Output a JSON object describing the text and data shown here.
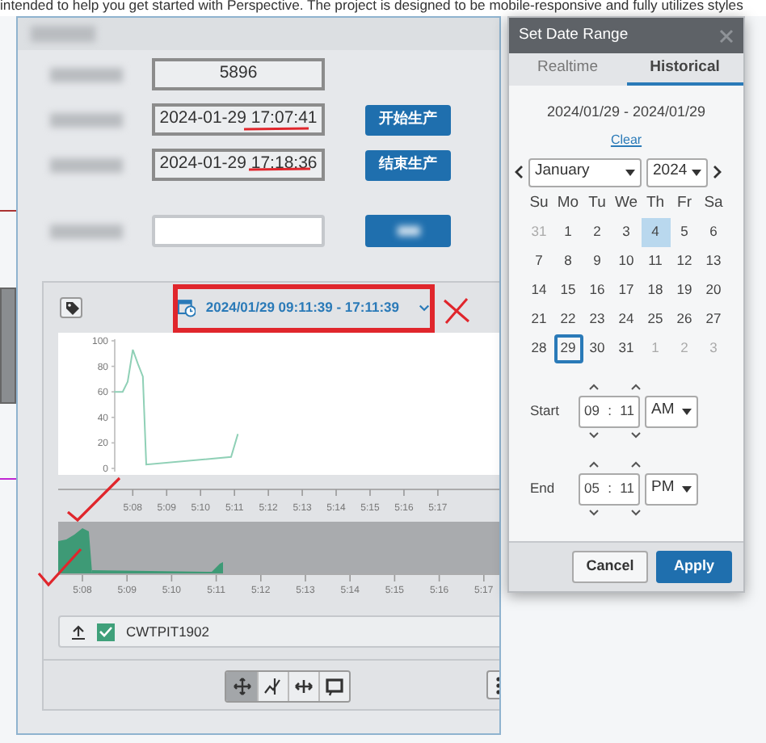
{
  "intro_text": "intended to help you get started with Perspective. The project is designed to be mobile-responsive and fully utilizes styles",
  "form": {
    "rows": [
      {
        "kind": "readout",
        "value": "5896"
      },
      {
        "kind": "readout_with_button",
        "value": "2024-01-29 17:07:41",
        "button": "开始生产"
      },
      {
        "kind": "readout_with_button",
        "value": "2024-01-29 17:18:36",
        "button": "结束生产"
      },
      {
        "kind": "input_with_blurred_button"
      }
    ]
  },
  "trend": {
    "range_button": "2024/01/29 09:11:39 - 17:11:39",
    "chart_data": {
      "type": "line",
      "x": [
        307.45,
        307.7,
        307.85,
        308.0,
        308.15,
        308.3,
        308.4,
        310.9,
        311.1
      ],
      "series": [
        {
          "name": "CWTPIT1902",
          "color": "#8fd0b6",
          "values": [
            60,
            60,
            68,
            93,
            82,
            72,
            3,
            9,
            27
          ]
        }
      ],
      "xlim": [
        305.8,
        319.1
      ],
      "ylim": [
        0,
        100
      ],
      "yticks": [
        0,
        20,
        40,
        60,
        80,
        100
      ],
      "xticks": [
        {
          "value": 308,
          "label": "5:08"
        },
        {
          "value": 309,
          "label": "5:09"
        },
        {
          "value": 310,
          "label": "5:10"
        },
        {
          "value": 311,
          "label": "5:11"
        },
        {
          "value": 312,
          "label": "5:12"
        },
        {
          "value": 313,
          "label": "5:13"
        },
        {
          "value": 314,
          "label": "5:14"
        },
        {
          "value": 315,
          "label": "5:15"
        },
        {
          "value": 316,
          "label": "5:16"
        },
        {
          "value": 317,
          "label": "5:17"
        }
      ]
    },
    "navigator_labels": [
      "5:08",
      "5:09",
      "5:10",
      "5:11",
      "5:12",
      "5:13",
      "5:14",
      "5:15",
      "5:16",
      "5:17"
    ],
    "legend": [
      {
        "checked": true,
        "color": "#3fa07a"
      }
    ],
    "tools": [
      {
        "kind": "pan",
        "selected": true
      },
      {
        "kind": "trace",
        "selected": false
      },
      {
        "kind": "xzoom",
        "selected": false
      },
      {
        "kind": "annotate",
        "selected": false
      }
    ]
  },
  "date_popup": {
    "title": "Set Date Range",
    "tabs": [
      {
        "label": "Realtime",
        "selected": false
      },
      {
        "label": "Historical",
        "selected": true
      }
    ],
    "range": "2024/01/29 - 2024/01/29",
    "clear": "Clear",
    "month": "January",
    "year": "2024",
    "weekdays": [
      "Su",
      "Mo",
      "Tu",
      "We",
      "Th",
      "Fr",
      "Sa"
    ],
    "days": [
      {
        "label": "31",
        "muted": true,
        "selected": false,
        "highlighted": false
      },
      {
        "label": "1",
        "muted": false,
        "selected": false,
        "highlighted": false
      },
      {
        "label": "2",
        "muted": false,
        "selected": false,
        "highlighted": false
      },
      {
        "label": "3",
        "muted": false,
        "selected": false,
        "highlighted": false
      },
      {
        "label": "4",
        "muted": false,
        "selected": false,
        "highlighted": true
      },
      {
        "label": "5",
        "muted": false,
        "selected": false,
        "highlighted": false
      },
      {
        "label": "6",
        "muted": false,
        "selected": false,
        "highlighted": false
      },
      {
        "label": "7",
        "muted": false,
        "selected": false,
        "highlighted": false
      },
      {
        "label": "8",
        "muted": false,
        "selected": false,
        "highlighted": false
      },
      {
        "label": "9",
        "muted": false,
        "selected": false,
        "highlighted": false
      },
      {
        "label": "10",
        "muted": false,
        "selected": false,
        "highlighted": false
      },
      {
        "label": "11",
        "muted": false,
        "selected": false,
        "highlighted": false
      },
      {
        "label": "12",
        "muted": false,
        "selected": false,
        "highlighted": false
      },
      {
        "label": "13",
        "muted": false,
        "selected": false,
        "highlighted": false
      },
      {
        "label": "14",
        "muted": false,
        "selected": false,
        "highlighted": false
      },
      {
        "label": "15",
        "muted": false,
        "selected": false,
        "highlighted": false
      },
      {
        "label": "16",
        "muted": false,
        "selected": false,
        "highlighted": false
      },
      {
        "label": "17",
        "muted": false,
        "selected": false,
        "highlighted": false
      },
      {
        "label": "18",
        "muted": false,
        "selected": false,
        "highlighted": false
      },
      {
        "label": "19",
        "muted": false,
        "selected": false,
        "highlighted": false
      },
      {
        "label": "20",
        "muted": false,
        "selected": false,
        "highlighted": false
      },
      {
        "label": "21",
        "muted": false,
        "selected": false,
        "highlighted": false
      },
      {
        "label": "22",
        "muted": false,
        "selected": false,
        "highlighted": false
      },
      {
        "label": "23",
        "muted": false,
        "selected": false,
        "highlighted": false
      },
      {
        "label": "24",
        "muted": false,
        "selected": false,
        "highlighted": false
      },
      {
        "label": "25",
        "muted": false,
        "selected": false,
        "highlighted": false
      },
      {
        "label": "26",
        "muted": false,
        "selected": false,
        "highlighted": false
      },
      {
        "label": "27",
        "muted": false,
        "selected": false,
        "highlighted": false
      },
      {
        "label": "28",
        "muted": false,
        "selected": false,
        "highlighted": false
      },
      {
        "label": "29",
        "muted": false,
        "selected": true,
        "highlighted": false
      },
      {
        "label": "30",
        "muted": false,
        "selected": false,
        "highlighted": false
      },
      {
        "label": "31",
        "muted": false,
        "selected": false,
        "highlighted": false
      },
      {
        "label": "1",
        "muted": true,
        "selected": false,
        "highlighted": false
      },
      {
        "label": "2",
        "muted": true,
        "selected": false,
        "highlighted": false
      },
      {
        "label": "3",
        "muted": true,
        "selected": false,
        "highlighted": false
      }
    ],
    "times": [
      {
        "label": "Start",
        "hour": "09",
        "separator": ":",
        "minute": "11",
        "period": "AM"
      },
      {
        "label": "End",
        "hour": "05",
        "separator": ":",
        "minute": "11",
        "period": "PM"
      }
    ],
    "buttons": [
      {
        "label": "Cancel",
        "kind": "secondary"
      },
      {
        "label": "Apply",
        "kind": "primary"
      }
    ]
  }
}
